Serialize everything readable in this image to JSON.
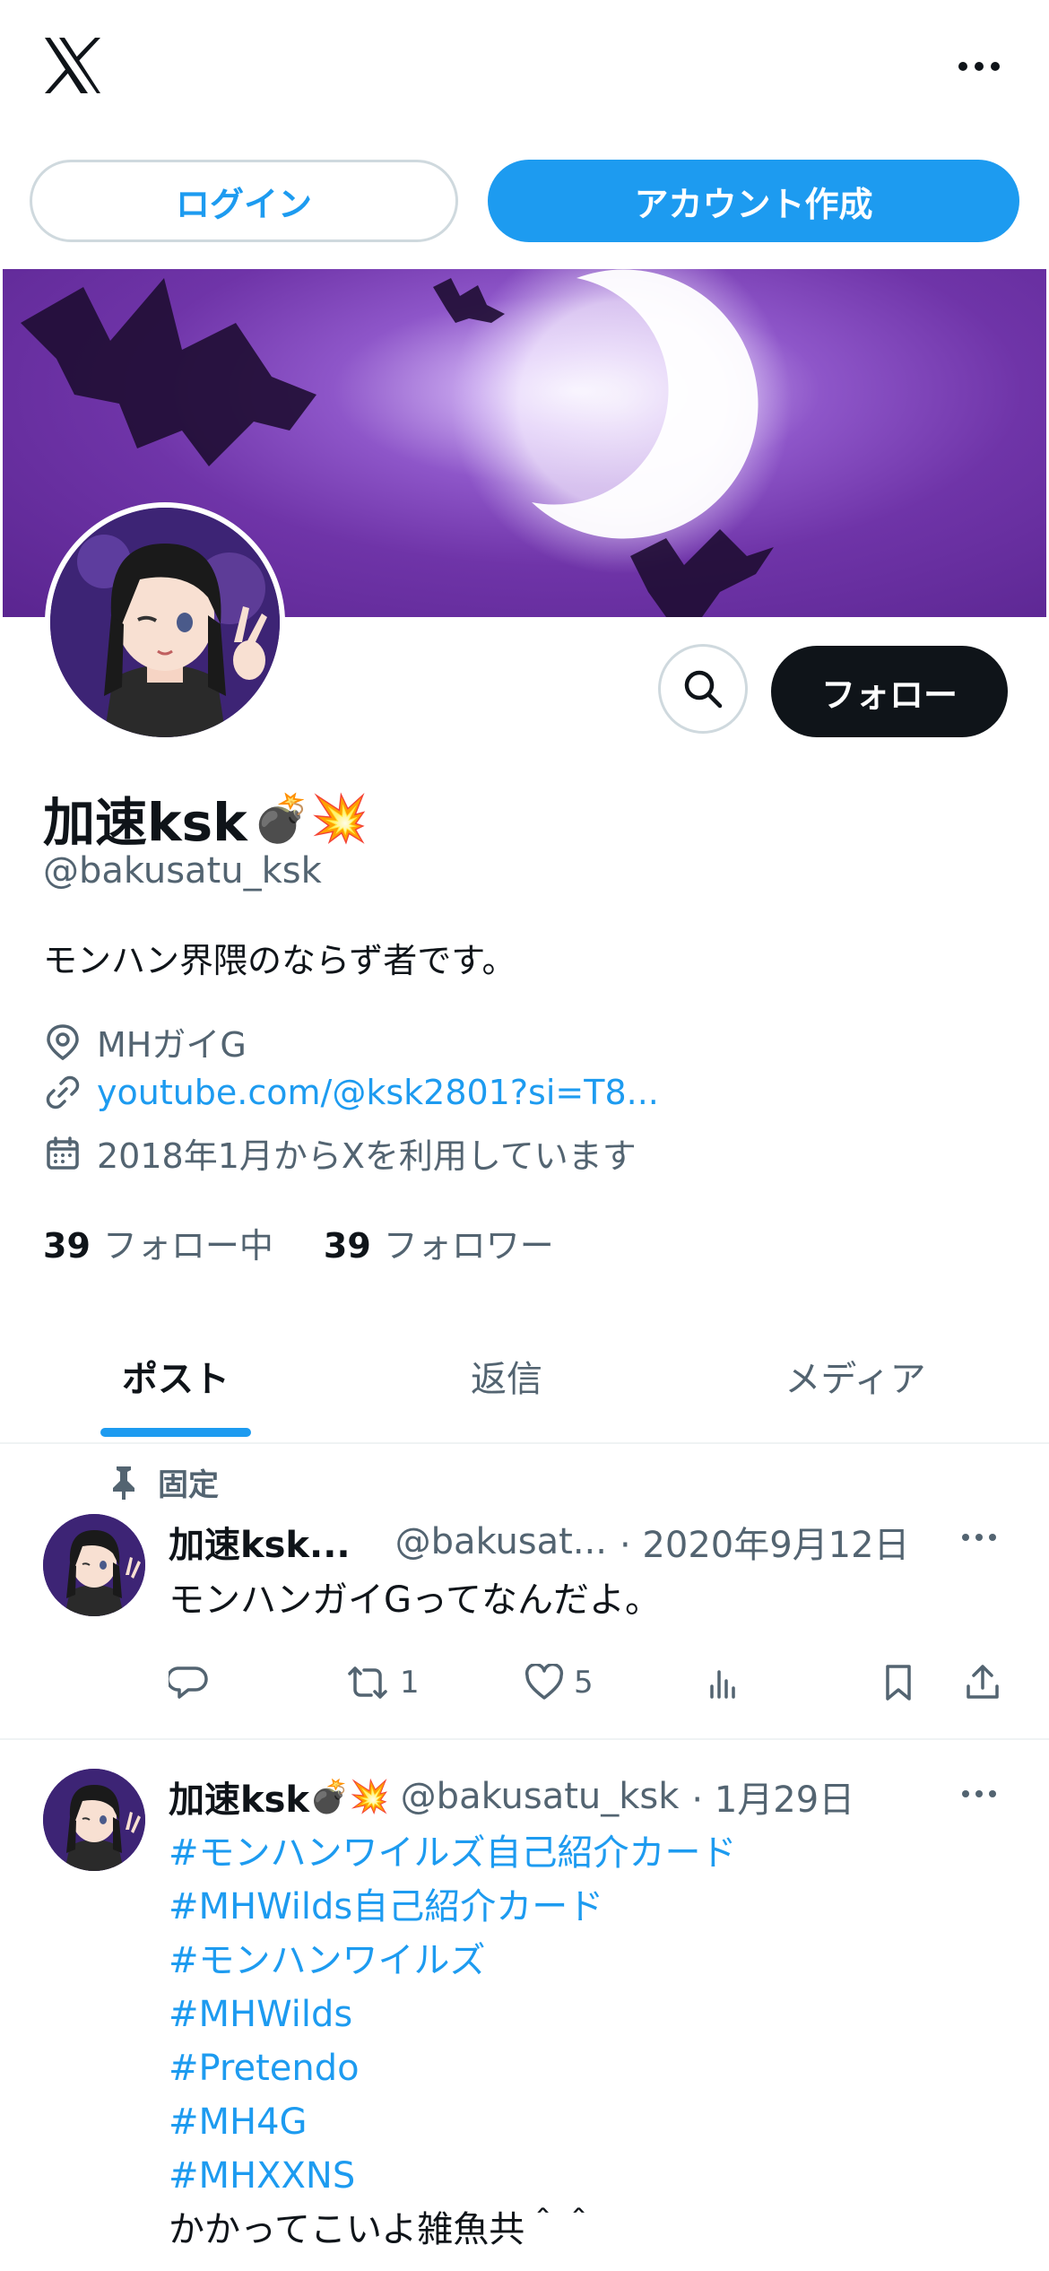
{
  "header": {
    "logo_icon": "x-logo-icon",
    "more_icon": "more-horizontal-icon"
  },
  "auth": {
    "login_label": "ログイン",
    "signup_label": "アカウント作成"
  },
  "profile": {
    "name": "加速ksk",
    "name_emojis": "💣💥",
    "handle": "@bakusatu_ksk",
    "bio": "モンハン界隈のならず者です。",
    "location": "MHガイG",
    "link": "youtube.com/@ksk2801?si=T8...",
    "joined": "2018年1月からXを利用しています",
    "following_count": "39",
    "following_label": "フォロー中",
    "followers_count": "39",
    "followers_label": "フォロワー",
    "follow_label": "フォロー"
  },
  "tabs": [
    {
      "label": "ポスト",
      "active": true
    },
    {
      "label": "返信",
      "active": false
    },
    {
      "label": "メディア",
      "active": false
    }
  ],
  "posts": [
    {
      "pinned_label": "固定",
      "name": "加速ksk...",
      "handle": "@bakusat...",
      "date": "· 2020年9月12日",
      "text": "モンハンガイGってなんだよ。",
      "retweets": "1",
      "likes": "5"
    },
    {
      "name": "加速ksk",
      "name_emojis": "💣💥",
      "handle": "@bakusatu_ksk",
      "date": "· 1月29日",
      "hashtags": [
        "#モンハンワイルズ自己紹介カード",
        "#MHWilds自己紹介カード",
        "#モンハンワイルズ",
        "#MHWilds",
        "#Pretendo",
        "#MH4G",
        "#MHXXNS"
      ],
      "closing_text": "かかってこいよ雑魚共＾＾"
    }
  ],
  "colors": {
    "accent": "#1d9bf0",
    "text": "#0f1419",
    "muted": "#536471",
    "border": "#cfd9de"
  }
}
